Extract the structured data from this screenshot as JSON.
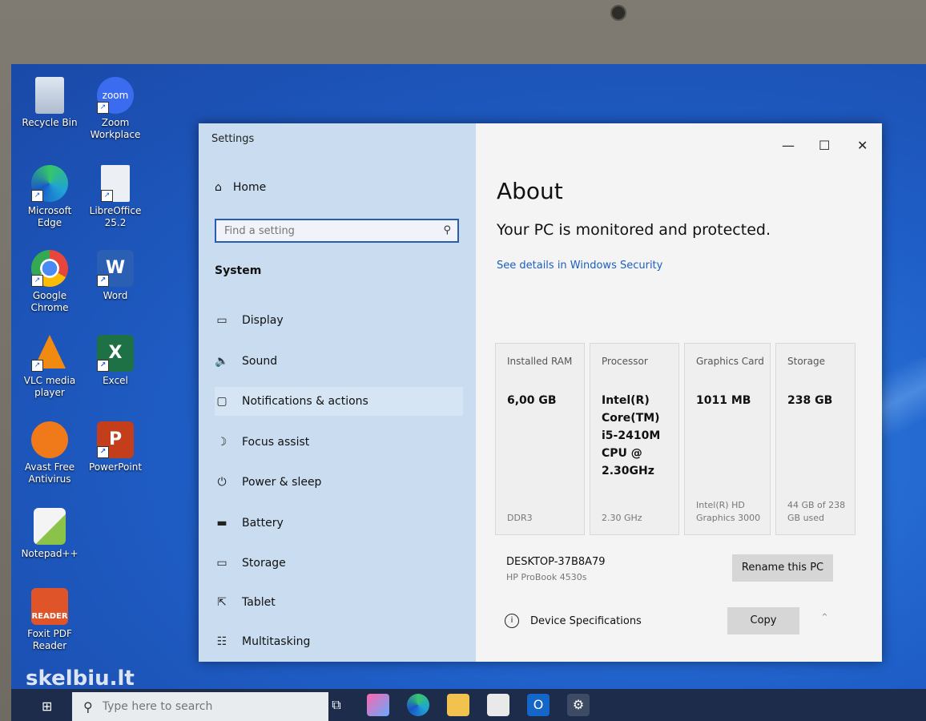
{
  "desktop": {
    "icons": [
      {
        "label": "Recycle Bin",
        "icon": "recycle-bin-icon",
        "color": "#cfd8e6"
      },
      {
        "label": "Zoom Workplace",
        "icon": "zoom-icon",
        "color": "#3b6cf0"
      },
      {
        "label": "Microsoft Edge",
        "icon": "edge-icon",
        "color": "#1fa2d6"
      },
      {
        "label": "LibreOffice 25.2",
        "icon": "libreoffice-icon",
        "color": "#e8e8e8"
      },
      {
        "label": "Google Chrome",
        "icon": "chrome-icon",
        "color": "#e8453c"
      },
      {
        "label": "Word",
        "icon": "word-icon",
        "color": "#2b5fb4"
      },
      {
        "label": "VLC media player",
        "icon": "vlc-icon",
        "color": "#f08a10"
      },
      {
        "label": "Excel",
        "icon": "excel-icon",
        "color": "#1e7145"
      },
      {
        "label": "Avast Free Antivirus",
        "icon": "avast-icon",
        "color": "#f07a1a"
      },
      {
        "label": "PowerPoint",
        "icon": "powerpoint-icon",
        "color": "#c43e1c"
      },
      {
        "label": "Notepad++",
        "icon": "notepad-plus-icon",
        "color": "#8bc34a"
      },
      {
        "label": "Foxit PDF Reader",
        "icon": "foxit-icon",
        "color": "#e0542a"
      }
    ],
    "icon_text": {
      "zoom": "zoom",
      "word": "W",
      "excel": "X",
      "powerpoint": "P",
      "foxit": "READER"
    }
  },
  "settings": {
    "window_title": "Settings",
    "home_label": "Home",
    "search_placeholder": "Find a setting",
    "section_title": "System",
    "nav": [
      {
        "label": "Display",
        "icon": "display-icon"
      },
      {
        "label": "Sound",
        "icon": "sound-icon"
      },
      {
        "label": "Notifications & actions",
        "icon": "notifications-icon"
      },
      {
        "label": "Focus assist",
        "icon": "focus-assist-icon"
      },
      {
        "label": "Power & sleep",
        "icon": "power-icon"
      },
      {
        "label": "Battery",
        "icon": "battery-icon"
      },
      {
        "label": "Storage",
        "icon": "storage-icon"
      },
      {
        "label": "Tablet",
        "icon": "tablet-icon"
      },
      {
        "label": "Multitasking",
        "icon": "multitasking-icon"
      }
    ],
    "about": {
      "title": "About",
      "protection": "Your PC is monitored and protected.",
      "security_link": "See details in Windows Security",
      "specs": [
        {
          "label": "Installed RAM",
          "value": "6,00 GB",
          "detail": "DDR3"
        },
        {
          "label": "Processor",
          "value": "Intel(R) Core(TM) i5-2410M CPU @ 2.30GHz",
          "detail": "2.30 GHz"
        },
        {
          "label": "Graphics Card",
          "value": "1011 MB",
          "detail": "Intel(R) HD Graphics 3000"
        },
        {
          "label": "Storage",
          "value": "238 GB",
          "detail": "44 GB of 238 GB used"
        }
      ],
      "device_name": "DESKTOP-37B8A79",
      "device_model": "HP ProBook 4530s",
      "rename_label": "Rename this PC",
      "spec_heading": "Device Specifications",
      "copy_label": "Copy"
    }
  },
  "taskbar": {
    "search_placeholder": "Type here to search"
  },
  "watermark": "skelbiu.lt"
}
